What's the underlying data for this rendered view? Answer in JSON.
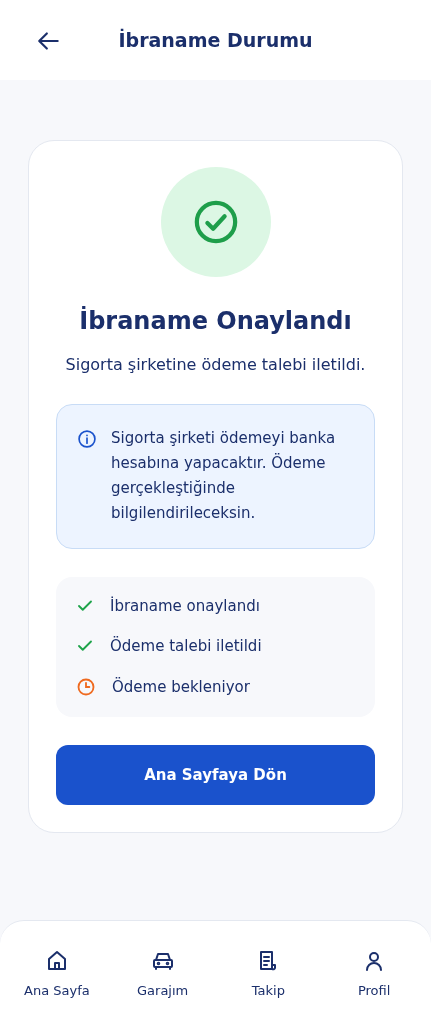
{
  "header": {
    "title": "İbraname Durumu"
  },
  "status": {
    "title": "İbraname Onaylandı",
    "subtitle": "Sigorta şirketine ödeme talebi iletildi."
  },
  "info": {
    "text": "Sigorta şirketi ödemeyi banka hesabına yapacaktır. Ödeme gerçekleştiğinde bilgilendirileceksin."
  },
  "steps": [
    {
      "label": "İbraname onaylandı",
      "kind": "done"
    },
    {
      "label": "Ödeme talebi iletildi",
      "kind": "done"
    },
    {
      "label": "Ödeme bekleniyor",
      "kind": "pending"
    }
  ],
  "button": {
    "label": "Ana Sayfaya Dön"
  },
  "nav": [
    {
      "label": "Ana Sayfa",
      "kind": "home"
    },
    {
      "label": "Garajım",
      "kind": "car"
    },
    {
      "label": "Takip",
      "kind": "receipt"
    },
    {
      "label": "Profil",
      "kind": "user"
    }
  ]
}
